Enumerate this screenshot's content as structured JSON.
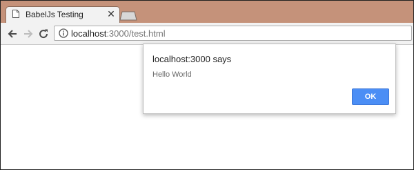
{
  "colors": {
    "tabstrip": "#c5927a",
    "ok_button": "#4b8ef5"
  },
  "tab": {
    "title": "BabelJs Testing",
    "close_glyph": "✕",
    "icon": "page-icon"
  },
  "toolbar": {
    "back_icon": "arrow-left-icon",
    "forward_icon": "arrow-right-icon",
    "reload_icon": "reload-icon"
  },
  "address_bar": {
    "host": "localhost",
    "rest": ":3000/test.html"
  },
  "alert": {
    "title": "localhost:3000 says",
    "message": "Hello World",
    "ok_label": "OK"
  }
}
